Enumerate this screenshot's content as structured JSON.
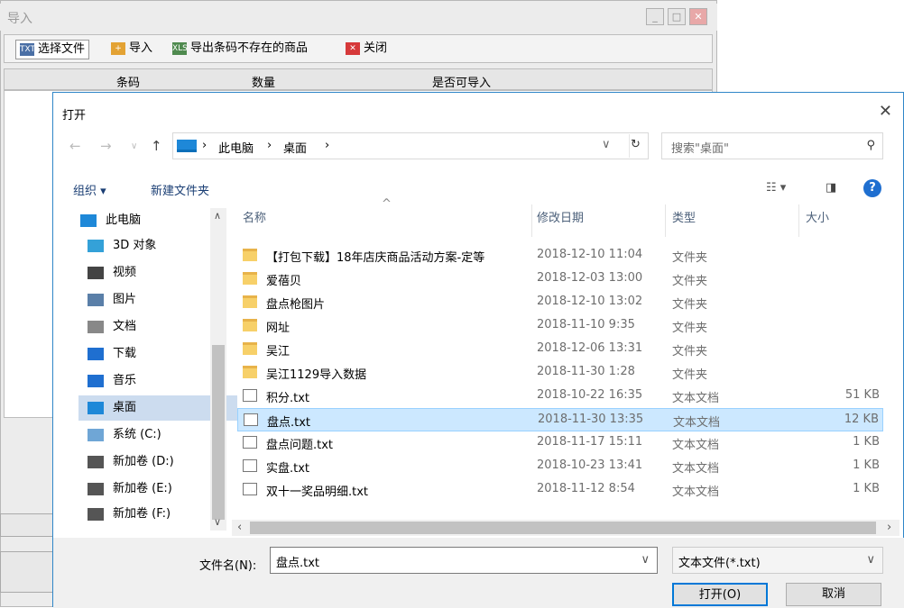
{
  "bg": {
    "title": "导入",
    "toolbar": {
      "select": "选择文件",
      "import": "导入",
      "export": "导出条码不存在的商品",
      "close": "关闭"
    },
    "cols": [
      "条码",
      "数量",
      "是否可导入"
    ]
  },
  "dlg": {
    "title": "打开",
    "path": [
      "此电脑",
      "桌面"
    ],
    "search_placeholder": "搜索\"桌面\"",
    "organize": "组织 ▾",
    "newfolder": "新建文件夹",
    "tree": [
      "此电脑",
      "3D 对象",
      "视频",
      "图片",
      "文档",
      "下载",
      "音乐",
      "桌面",
      "系统 (C:)",
      "新加卷 (D:)",
      "新加卷 (E:)",
      "新加卷 (F:)"
    ],
    "headers": [
      "名称",
      "修改日期",
      "类型",
      "大小"
    ],
    "files": [
      [
        "【打包下载】18年店庆商品活动方案-定等",
        "2018-12-10 11:04",
        "文件夹",
        ""
      ],
      [
        "爱蓓贝",
        "2018-12-03 13:00",
        "文件夹",
        ""
      ],
      [
        "盘点枪图片",
        "2018-12-10 13:02",
        "文件夹",
        ""
      ],
      [
        "网址",
        "2018-11-10 9:35",
        "文件夹",
        ""
      ],
      [
        "吴江",
        "2018-12-06 13:31",
        "文件夹",
        ""
      ],
      [
        "吴江1129导入数据",
        "2018-11-30 1:28",
        "文件夹",
        ""
      ],
      [
        "积分.txt",
        "2018-10-22 16:35",
        "文本文档",
        "51 KB"
      ],
      [
        "盘点.txt",
        "2018-11-30 13:35",
        "文本文档",
        "12 KB"
      ],
      [
        "盘点问题.txt",
        "2018-11-17 15:11",
        "文本文档",
        "1 KB"
      ],
      [
        "实盘.txt",
        "2018-10-23 13:41",
        "文本文档",
        "1 KB"
      ],
      [
        "双十一奖品明细.txt",
        "2018-11-12 8:54",
        "文本文档",
        "1 KB"
      ]
    ],
    "filename_label": "文件名(N):",
    "filename": "盘点.txt",
    "filetype": "文本文件(*.txt)",
    "open": "打开(O)",
    "cancel": "取消"
  },
  "colors": {
    "accent": "#0078d7",
    "selected": "#cce8ff",
    "folder": "#f7d069"
  }
}
